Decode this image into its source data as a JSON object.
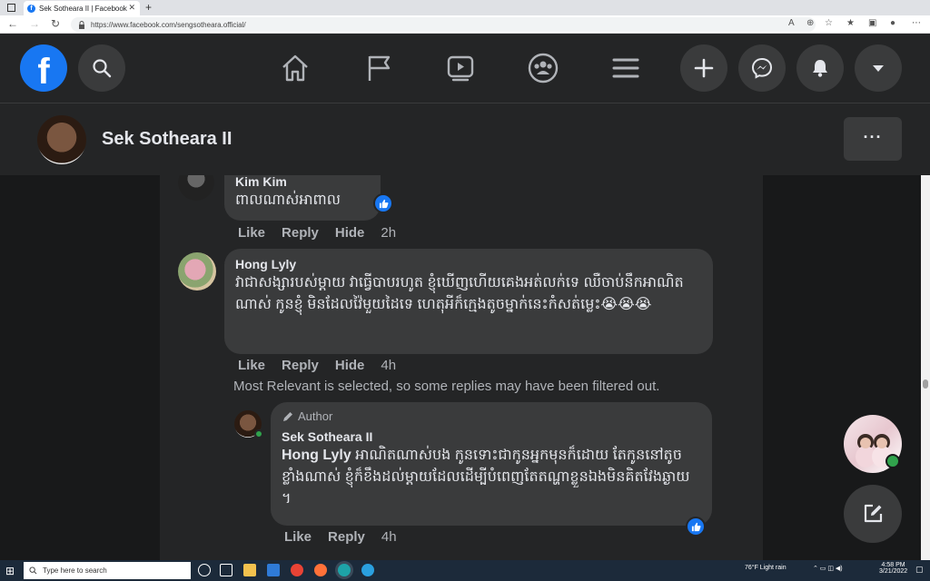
{
  "browser": {
    "tab_title": "Sek Sotheara II | Facebook",
    "url": "https://www.facebook.com/sengsotheara.official/"
  },
  "profile": {
    "name": "Sek Sotheara II",
    "more": "···"
  },
  "comments": [
    {
      "name": "Kim Kim",
      "text": "ពាលណាស់អាពាល",
      "actions": {
        "like": "Like",
        "reply": "Reply",
        "hide": "Hide",
        "time": "2h"
      }
    },
    {
      "name": "Hong Lyly",
      "text": "វាជាសង្សារបស់ម្ដាយ វាធ្វើបាបរហូត ខ្ញុំឃើញហើយគេងអត់លក់ទេ ឈឺចាប់នឹកអាណិតណាស់ កូនខ្ញុំ មិនដែលវ៉ៃមួយដៃទេ ហេតុអីក៏ក្មេងតូចម្នាក់នេះកំសត់ម្លេះ😭😭😭",
      "actions": {
        "like": "Like",
        "reply": "Reply",
        "hide": "Hide",
        "time": "4h"
      }
    }
  ],
  "filter_note": "Most Relevant is selected, so some replies may have been filtered out.",
  "reply": {
    "author_tag": "Author",
    "name": "Sek Sotheara II",
    "mention": "Hong Lyly",
    "text": " អាណិតណាស់បង កូនទោះជាកូនអ្នកមុនក៏ដោយ តែកូននៅតូចខ្លាំងណាស់ ខ្ញុំក៏ខឹងដល់ម្ដាយដែលដើម្បីបំពេញតែតណ្ហាខ្លួនឯងមិនគិតវែងឆ្ងាយ ។",
    "actions": {
      "like": "Like",
      "reply": "Reply",
      "time": "4h"
    }
  },
  "taskbar": {
    "search_placeholder": "Type here to search",
    "weather": "76°F  Light rain",
    "time": "4:58 PM",
    "date": "3/21/2022"
  },
  "colors": {
    "facebook_blue": "#1877f2",
    "bubble_bg": "#3a3b3c",
    "panel_bg": "#242526"
  }
}
